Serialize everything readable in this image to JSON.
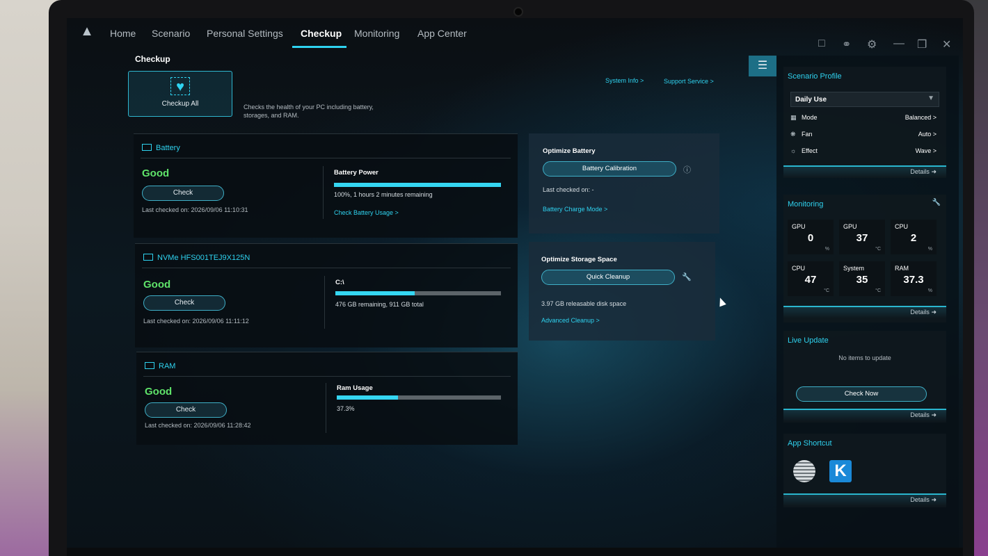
{
  "nav": {
    "items": [
      "Home",
      "Scenario",
      "Personal Settings",
      "Checkup",
      "Monitoring",
      "App Center"
    ],
    "active": "Checkup"
  },
  "checkup": {
    "title": "Checkup",
    "checkup_all_label": "Checkup All",
    "description": "Checks the health of your PC including battery, storages, and RAM.",
    "system_info": "System Info >",
    "support_service": "Support Service >"
  },
  "battery": {
    "title": "Battery",
    "status": "Good",
    "check_label": "Check",
    "last_checked": "Last checked on: 2026/09/06 11:10:31",
    "metric_title": "Battery Power",
    "metric_percent": 100,
    "metric_text": "100%, 1 hours 2 minutes remaining",
    "link": "Check Battery Usage >"
  },
  "storage": {
    "title": "NVMe HFS001TEJ9X125N",
    "status": "Good",
    "check_label": "Check",
    "last_checked": "Last checked on: 2026/09/06 11:11:12",
    "metric_title": "C:\\",
    "metric_percent": 48,
    "metric_text": "476 GB remaining, 911 GB total"
  },
  "ram": {
    "title": "RAM",
    "status": "Good",
    "check_label": "Check",
    "last_checked": "Last checked on: 2026/09/06 11:28:42",
    "metric_title": "Ram Usage",
    "metric_percent": 37.3,
    "metric_text": "37.3%"
  },
  "optimize_battery": {
    "title": "Optimize Battery",
    "button": "Battery Calibration",
    "last_checked": "Last checked on: -",
    "link": "Battery Charge Mode >"
  },
  "optimize_storage": {
    "title": "Optimize Storage Space",
    "button": "Quick Cleanup",
    "text": "3.97 GB releasable disk space",
    "link": "Advanced Cleanup >"
  },
  "sidebar": {
    "scenario": {
      "title": "Scenario Profile",
      "selected": "Daily Use",
      "rows": [
        {
          "label": "Mode",
          "value": "Balanced >"
        },
        {
          "label": "Fan",
          "value": "Auto >"
        },
        {
          "label": "Effect",
          "value": "Wave >"
        }
      ],
      "details": "Details"
    },
    "monitoring": {
      "title": "Monitoring",
      "tiles": [
        {
          "label": "GPU",
          "value": "0",
          "unit": "%"
        },
        {
          "label": "GPU",
          "value": "37",
          "unit": "°C"
        },
        {
          "label": "CPU",
          "value": "2",
          "unit": "%"
        },
        {
          "label": "CPU",
          "value": "47",
          "unit": "°C"
        },
        {
          "label": "System",
          "value": "35",
          "unit": "°C"
        },
        {
          "label": "RAM",
          "value": "37.3",
          "unit": "%"
        }
      ],
      "details": "Details"
    },
    "live_update": {
      "title": "Live Update",
      "note": "No items to update",
      "button": "Check Now",
      "details": "Details"
    },
    "app_shortcut": {
      "title": "App Shortcut",
      "app2_glyph": "K",
      "details": "Details"
    }
  },
  "colors": {
    "accent": "#2fd3f0",
    "good": "#5fe36a"
  }
}
